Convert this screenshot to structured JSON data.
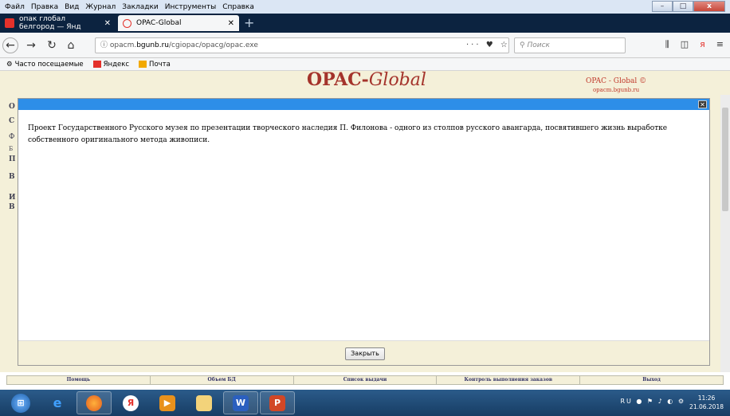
{
  "menubar": {
    "items": [
      "Файл",
      "Правка",
      "Вид",
      "Журнал",
      "Закладки",
      "Инструменты",
      "Справка"
    ]
  },
  "tabs": [
    {
      "title": "опак глобал белгород — Янд",
      "active": false
    },
    {
      "title": "OPAC-Global",
      "active": true
    }
  ],
  "nav": {
    "url_prefix": "opacm.",
    "url_host": "bgunb.ru",
    "url_path": "/cgiopac/opacg/opac.exe",
    "url_actions": "··· ♥ ☆",
    "search_placeholder": "Поиск"
  },
  "bookmarks": [
    "Часто посещаемые",
    "Яндекс",
    "Почта"
  ],
  "page": {
    "logo_main": "OPAC-",
    "logo_italic": "Global",
    "right_title": "OPAC - Global ©",
    "right_sub": "opacm.bgunb.ru",
    "left_letters": [
      "О",
      "С",
      "Ф",
      "Б",
      "П",
      "В",
      "И",
      "В"
    ]
  },
  "modal": {
    "text": "Проект Государственного Русского музея по презентации творческого наследия П. Филонова - одного из столпов русского авангарда, посвятившего жизнь выработке собственного оригинального метода живописи.",
    "close_label": "Закрыть"
  },
  "footer_nav": [
    "Помощь",
    "Объем БД",
    "Список выдачи",
    "Контроль выполнения заказов",
    "Выход"
  ],
  "taskbar": {
    "tray_lang": "RU",
    "clock_time": "11:26",
    "clock_date": "21.06.2018"
  },
  "colors": {
    "accent": "#2d8ee8",
    "logo": "#a4332b",
    "page_bg": "#f4f0d9"
  }
}
